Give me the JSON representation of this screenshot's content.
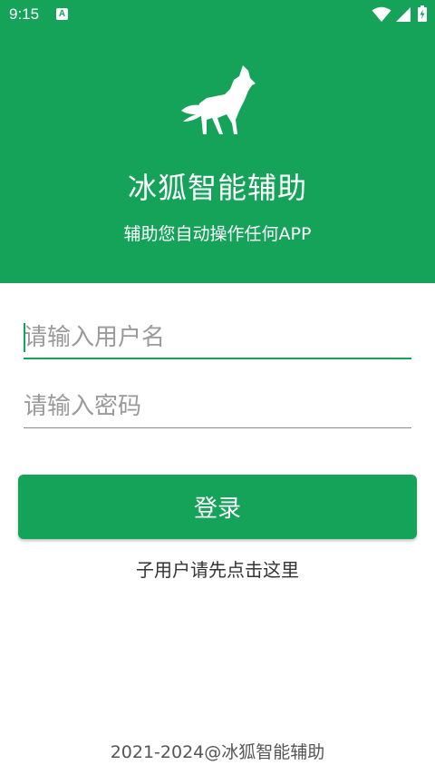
{
  "status_bar": {
    "time": "9:15",
    "notification_glyph": "A",
    "icons": [
      "wifi-icon",
      "signal-icon",
      "battery-charging-icon"
    ]
  },
  "header": {
    "logo_icon": "fox-icon",
    "title": "冰狐智能辅助",
    "subtitle": "辅助您自动操作任何APP"
  },
  "form": {
    "username_placeholder": "请输入用户名",
    "username_value": "",
    "password_placeholder": "请输入密码",
    "password_value": "",
    "login_label": "登录",
    "sub_user_link": "子用户请先点击这里"
  },
  "footer": {
    "copyright": "2021-2024@冰狐智能辅助"
  },
  "colors": {
    "primary": "#15a35a",
    "background": "#ffffff"
  }
}
